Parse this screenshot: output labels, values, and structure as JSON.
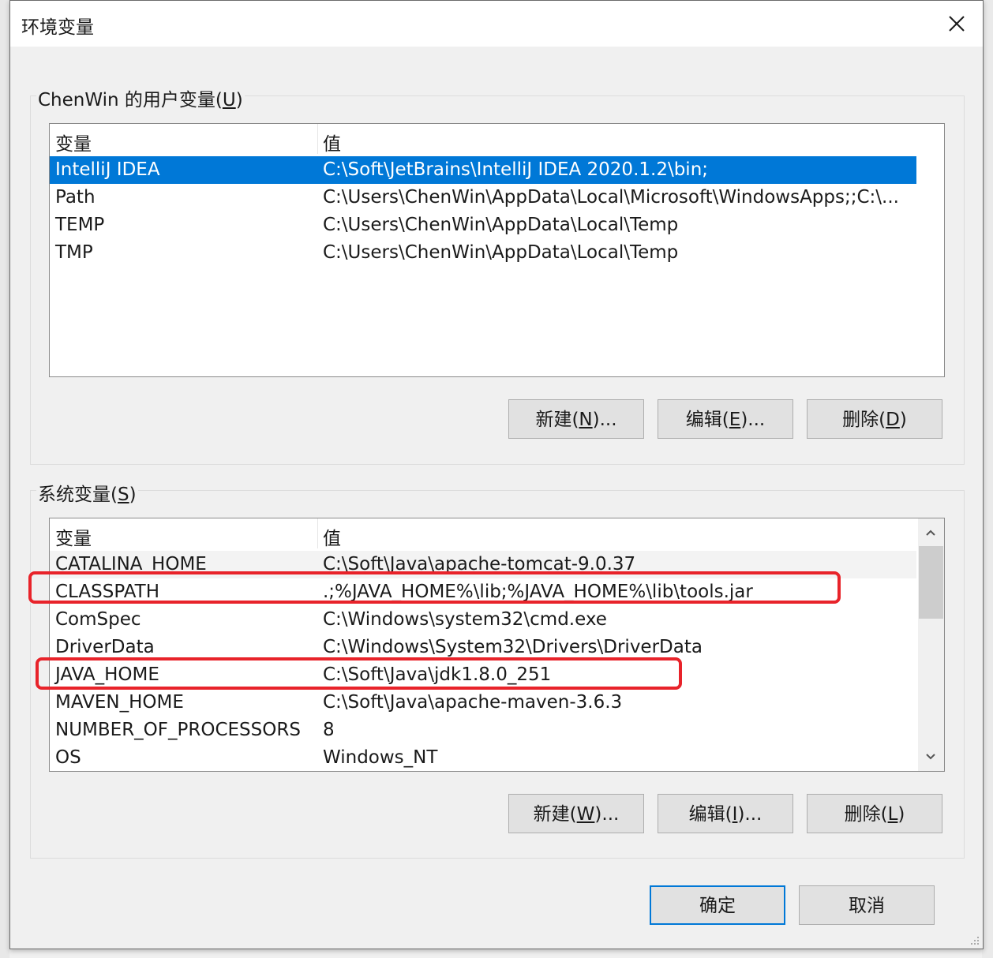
{
  "window": {
    "title": "环境变量",
    "close_icon": "close-icon"
  },
  "user_vars": {
    "group_label_prefix": "ChenWin 的用户变量(",
    "group_label_key": "U",
    "group_label_suffix": ")",
    "columns": [
      "变量",
      "值"
    ],
    "rows": [
      {
        "name": "IntelliJ IDEA",
        "value": "C:\\Soft\\JetBrains\\IntelliJ IDEA 2020.1.2\\bin;",
        "selected": true
      },
      {
        "name": "Path",
        "value": "C:\\Users\\ChenWin\\AppData\\Local\\Microsoft\\WindowsApps;;C:\\..."
      },
      {
        "name": "TEMP",
        "value": "C:\\Users\\ChenWin\\AppData\\Local\\Temp"
      },
      {
        "name": "TMP",
        "value": "C:\\Users\\ChenWin\\AppData\\Local\\Temp"
      }
    ],
    "buttons": {
      "new": {
        "prefix": "新建(",
        "key": "N",
        "suffix": ")..."
      },
      "edit": {
        "prefix": "编辑(",
        "key": "E",
        "suffix": ")..."
      },
      "delete": {
        "prefix": "删除(",
        "key": "D",
        "suffix": ")"
      }
    }
  },
  "system_vars": {
    "group_label_prefix": "系统变量(",
    "group_label_key": "S",
    "group_label_suffix": ")",
    "columns": [
      "变量",
      "值"
    ],
    "rows": [
      {
        "name": "CATALINA_HOME",
        "value": "C:\\Soft\\Java\\apache-tomcat-9.0.37"
      },
      {
        "name": "CLASSPATH",
        "value": ".;%JAVA_HOME%\\lib;%JAVA_HOME%\\lib\\tools.jar",
        "highlighted": true
      },
      {
        "name": "ComSpec",
        "value": "C:\\Windows\\system32\\cmd.exe"
      },
      {
        "name": "DriverData",
        "value": "C:\\Windows\\System32\\Drivers\\DriverData"
      },
      {
        "name": "JAVA_HOME",
        "value": "C:\\Soft\\Java\\jdk1.8.0_251",
        "highlighted": true
      },
      {
        "name": "MAVEN_HOME",
        "value": "C:\\Soft\\Java\\apache-maven-3.6.3"
      },
      {
        "name": "NUMBER_OF_PROCESSORS",
        "value": "8"
      },
      {
        "name": "OS",
        "value": "Windows_NT"
      }
    ],
    "buttons": {
      "new": {
        "prefix": "新建(",
        "key": "W",
        "suffix": ")..."
      },
      "edit": {
        "prefix": "编辑(",
        "key": "I",
        "suffix": ")..."
      },
      "delete": {
        "prefix": "删除(",
        "key": "L",
        "suffix": ")"
      }
    }
  },
  "footer": {
    "ok": "确定",
    "cancel": "取消"
  },
  "colors": {
    "selection": "#0078d7",
    "highlight_box": "#e8232a"
  }
}
